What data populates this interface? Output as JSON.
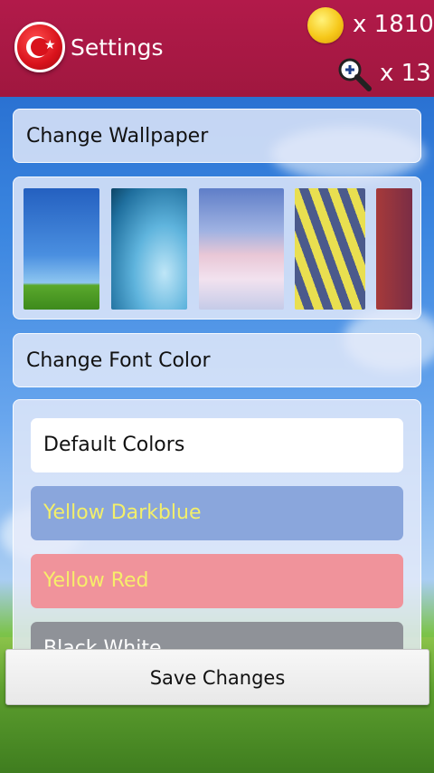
{
  "header": {
    "title": "Settings",
    "coins": "x 1810",
    "hints": "x 13",
    "logo_icon": "turkey-flag-logo-icon",
    "coin_icon": "gold-coin-icon",
    "hint_icon": "magnifier-plus-icon"
  },
  "wallpaper": {
    "label": "Change Wallpaper",
    "thumbnails": [
      "sky-grass-wallpaper",
      "wave-wallpaper",
      "clouds-wallpaper",
      "stripes-wallpaper",
      "red-wallpaper"
    ]
  },
  "font_color": {
    "label": "Change Font Color",
    "options": [
      {
        "label": "Default Colors",
        "bg": "#ffffff",
        "fg": "#111111"
      },
      {
        "label": "Yellow Darkblue",
        "bg": "#8aa6dc",
        "fg": "#f3ef6a"
      },
      {
        "label": "Yellow Red",
        "bg": "#f0939b",
        "fg": "#f7ee6a"
      },
      {
        "label": "Black White",
        "bg": "#8f9298",
        "fg": "#ffffff"
      }
    ]
  },
  "save_button": "Save Changes",
  "colors": {
    "header": "#a0173f",
    "sky": "#3b86e0",
    "grass": "#4f9a2a"
  }
}
